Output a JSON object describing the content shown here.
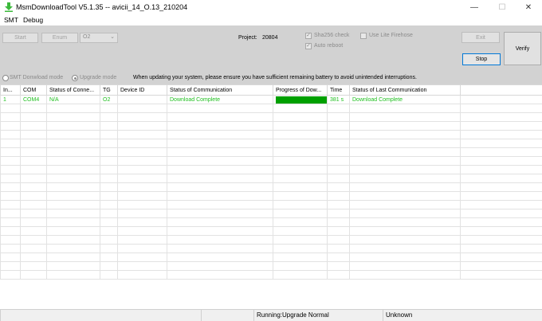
{
  "window": {
    "title": "MsmDownloadTool V5.1.35 -- avicii_14_O.13_210204",
    "minimize": "—",
    "maximize": "☐",
    "close": "✕"
  },
  "menu": {
    "items": [
      "SMT",
      "Debug"
    ]
  },
  "controls": {
    "start_label": "Start",
    "enum_label": "Enum",
    "target_select": "O2",
    "project_label": "Project:",
    "project_value": "20804",
    "sha256_label": "Sha256 check",
    "use_lite_label": "Use Lite Firehose",
    "auto_reboot_label": "Auto reboot",
    "exit_label": "Exit",
    "stop_label": "Stop",
    "verify_label": "Verify",
    "smt_mode_label": "SMT Donwload mode",
    "upgrade_mode_label": "Upgrade mode",
    "notice": "When updating your system, please ensure you have sufficient remaining battery to avoid unintended interruptions."
  },
  "table": {
    "columns": [
      "In...",
      "COM",
      "Status of Conne...",
      "TG",
      "Device ID",
      "Status of Communication",
      "Progress of Dow...",
      "Time",
      "Status of Last Communication"
    ],
    "rows": [
      {
        "index": "1",
        "com": "COM4",
        "status_conn": "N/A",
        "tg": "O2",
        "device_id": "",
        "status_comm": "Download Complete",
        "progress": 1.0,
        "time": "381 s",
        "status_last": "Download Complete"
      }
    ]
  },
  "statusbar": {
    "running": "Running:Upgrade Normal",
    "unknown": "Unknown"
  },
  "colors": {
    "progress": "#00a000",
    "ok_text": "#1fbf1f",
    "accent": "#0078d7"
  }
}
